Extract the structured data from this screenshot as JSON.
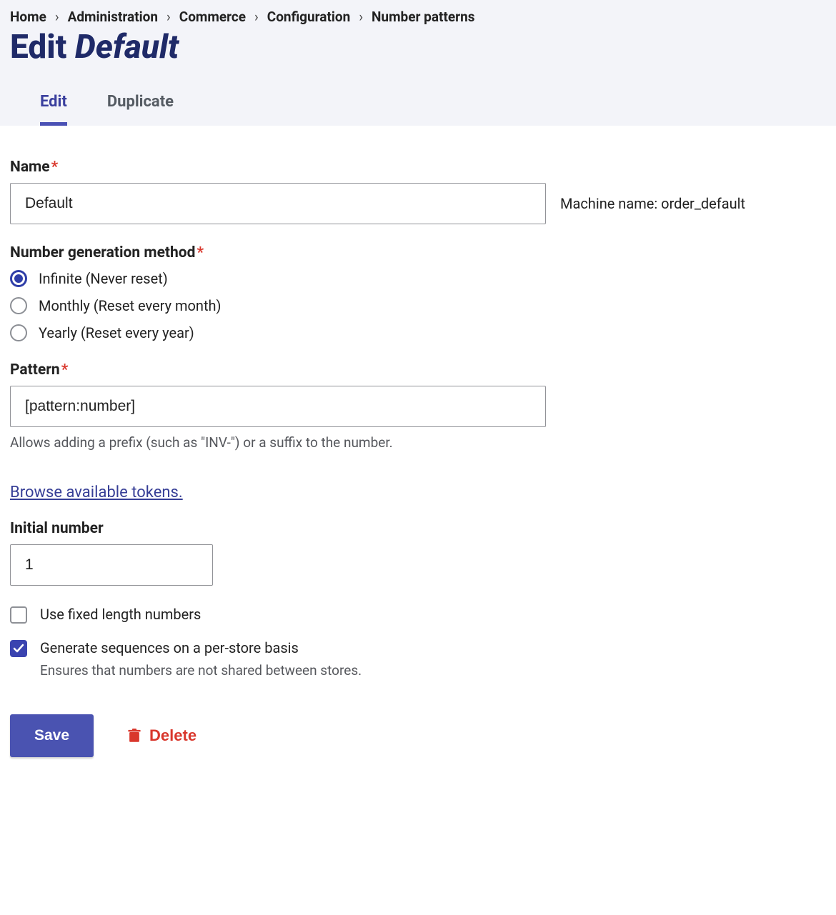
{
  "breadcrumb": {
    "items": [
      "Home",
      "Administration",
      "Commerce",
      "Configuration",
      "Number patterns"
    ]
  },
  "page_title": {
    "prefix": "Edit ",
    "entity": "Default"
  },
  "tabs": {
    "edit": "Edit",
    "duplicate": "Duplicate",
    "active": "edit"
  },
  "name": {
    "label": "Name",
    "value": "Default"
  },
  "machine_name": {
    "label": "Machine name: ",
    "value": "order_default"
  },
  "generation": {
    "label": "Number generation method",
    "selected": "infinite",
    "options": {
      "infinite": "Infinite (Never reset)",
      "monthly": "Monthly (Reset every month)",
      "yearly": "Yearly (Reset every year)"
    }
  },
  "pattern": {
    "label": "Pattern",
    "value": "[pattern:number]",
    "description": "Allows adding a prefix (such as \"INV-\") or a suffix to the number."
  },
  "tokens_link": "Browse available tokens.",
  "initial_number": {
    "label": "Initial number",
    "value": "1"
  },
  "fixed_length": {
    "label": "Use fixed length numbers",
    "checked": false
  },
  "per_store": {
    "label": "Generate sequences on a per-store basis",
    "description": "Ensures that numbers are not shared between stores.",
    "checked": true
  },
  "actions": {
    "save": "Save",
    "delete": "Delete"
  }
}
